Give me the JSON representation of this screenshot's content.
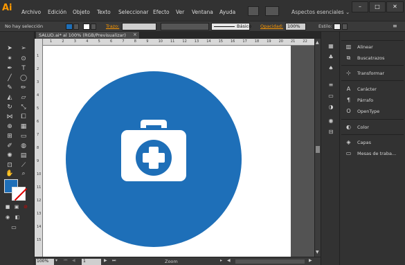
{
  "app": {
    "logo": "Ai"
  },
  "menu": [
    "Archivo",
    "Edición",
    "Objeto",
    "Texto",
    "Seleccionar",
    "Efecto",
    "Ver",
    "Ventana",
    "Ayuda"
  ],
  "workspace": {
    "label": "Aspectos esenciales ⌄"
  },
  "window_controls": {
    "minimize": "–",
    "maximize": "□",
    "close": "✕"
  },
  "control_bar": {
    "selection": "No hay selección",
    "stroke_label": "Trazo:",
    "brush": "Básico",
    "opacity_label": "Opacidad:",
    "opacity_value": "100%",
    "style_label": "Estilo:"
  },
  "document": {
    "tab_title": "SALUD.ai* al 100% (RGB/Previsualizar)",
    "close": "×"
  },
  "rulers": {
    "horizontal": [
      "1",
      "2",
      "3",
      "4",
      "5",
      "6",
      "7",
      "8",
      "9",
      "10",
      "11",
      "12",
      "13",
      "14",
      "15",
      "16",
      "17",
      "18",
      "19",
      "20",
      "21",
      "22"
    ],
    "vertical": [
      "1",
      "2",
      "3",
      "4",
      "5",
      "6",
      "7",
      "8",
      "9",
      "10",
      "11",
      "12",
      "13",
      "14",
      "15"
    ]
  },
  "status_bar": {
    "zoom": "100%",
    "page": "1",
    "label": "Zoom"
  },
  "colors": {
    "fill": "#1e6fb8",
    "artwork_circle": "#1e6fb8",
    "artwork_icon": "#ffffff",
    "accent": "#ff9a00"
  },
  "artwork": {
    "icon": "medical-kit-icon"
  },
  "panels": [
    {
      "icon": "align-icon",
      "glyph": "▥",
      "label": "Alinear"
    },
    {
      "icon": "pathfinder-icon",
      "glyph": "⧉",
      "label": "Buscatrazos"
    },
    {
      "icon": "transform-icon",
      "glyph": "⊹",
      "label": "Transformar"
    },
    {
      "icon": "character-icon",
      "glyph": "A",
      "label": "Carácter"
    },
    {
      "icon": "paragraph-icon",
      "glyph": "¶",
      "label": "Párrafo"
    },
    {
      "icon": "opentype-icon",
      "glyph": "O",
      "label": "OpenType"
    },
    {
      "icon": "color-icon",
      "glyph": "◐",
      "label": "Color"
    },
    {
      "icon": "layers-icon",
      "glyph": "◈",
      "label": "Capas"
    },
    {
      "icon": "artboards-icon",
      "glyph": "▭",
      "label": "Mesas de traba..."
    }
  ]
}
